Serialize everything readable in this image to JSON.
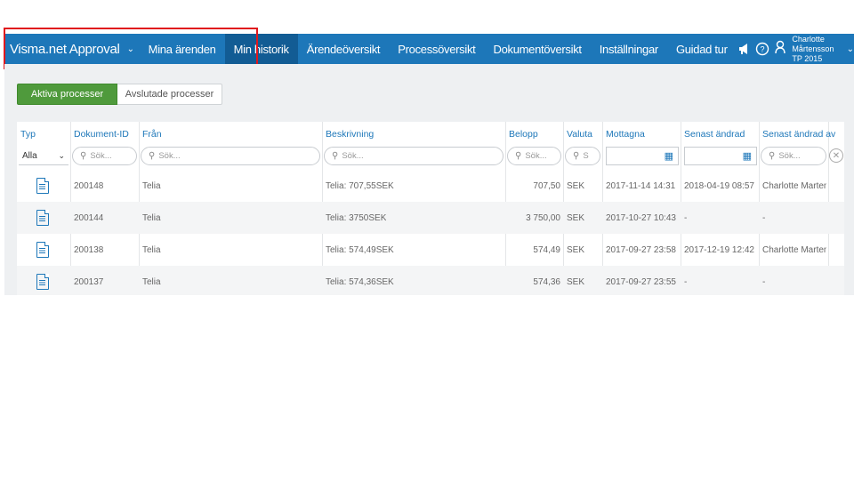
{
  "nav": {
    "brand": "Visma.net Approval",
    "items": [
      {
        "label": "Mina ärenden"
      },
      {
        "label": "Min historik"
      },
      {
        "label": "Ärendeöversikt"
      },
      {
        "label": "Processöversikt"
      },
      {
        "label": "Dokumentöversikt"
      },
      {
        "label": "Inställningar"
      }
    ],
    "guided_tour": "Guidad tur",
    "user_name": "Charlotte Mårtensson",
    "user_company": "TP 2015"
  },
  "tabs": {
    "active": "Aktiva processer",
    "closed": "Avslutade processer"
  },
  "table": {
    "columns": [
      "Typ",
      "Dokument-ID",
      "Från",
      "Beskrivning",
      "Belopp",
      "Valuta",
      "Mottagna",
      "Senast ändrad",
      "Senast ändrad av"
    ],
    "type_filter": "Alla",
    "search_placeholder": "Sök...",
    "search_placeholder_short": "S",
    "rows": [
      {
        "id": "200148",
        "from": "Telia",
        "desc": "Telia: 707,55SEK",
        "amount": "707,50",
        "currency": "SEK",
        "received": "2017-11-14 14:31",
        "changed": "2018-04-19 08:57",
        "changed_by": "Charlotte Marten..."
      },
      {
        "id": "200144",
        "from": "Telia",
        "desc": "Telia: 3750SEK",
        "amount": "3 750,00",
        "currency": "SEK",
        "received": "2017-10-27 10:43",
        "changed": "-",
        "changed_by": "-"
      },
      {
        "id": "200138",
        "from": "Telia",
        "desc": "Telia: 574,49SEK",
        "amount": "574,49",
        "currency": "SEK",
        "received": "2017-09-27 23:58",
        "changed": "2017-12-19 12:42",
        "changed_by": "Charlotte Marten..."
      },
      {
        "id": "200137",
        "from": "Telia",
        "desc": "Telia: 574,36SEK",
        "amount": "574,36",
        "currency": "SEK",
        "received": "2017-09-27 23:55",
        "changed": "-",
        "changed_by": "-"
      }
    ]
  }
}
